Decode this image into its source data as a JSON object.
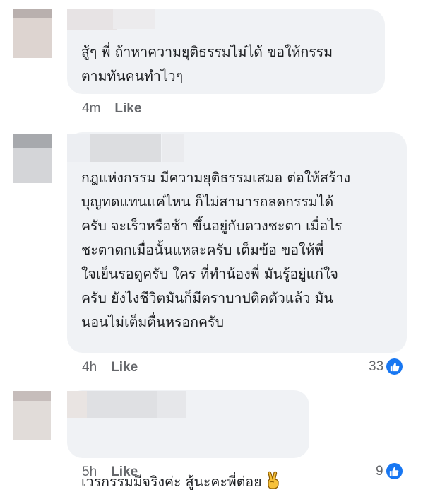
{
  "comments": [
    {
      "text": "สู้ๆ พี่ ถ้าหาความยุติธรรมไม่ได้ ขอให้กรรม\nตามทันคนทำไวๆ",
      "time": "4m",
      "like_label": "Like"
    },
    {
      "text": "กฎแห่งกรรม มีความยุติธรรมเสมอ ต่อให้สร้าง\nบุญทดแทนแค่ไหน ก็ไม่สามารถลดกรรมได้\nครับ จะเร็วหรือช้า ขึ้นอยู่กับดวงชะตา เมื่อไร\nชะตาตกเมื่อนั้นแหละครับ เต็มข้อ ขอให้พี่\nใจเย็นรอดูครับ ใคร ที่ทำน้องพี่ มันรู้อยู่แก่ใจ\nครับ ยังไงชีวิตมันก็มีตราบาปติดตัวแล้ว มัน\nนอนไม่เต็มตื่นหรอกครับ",
      "time": "4h",
      "like_label": "Like",
      "reaction_count": "33"
    },
    {
      "text": "เวรกรรมมีจริงค่ะ สู้นะคะพี่ต่อย",
      "time": "5h",
      "like_label": "Like",
      "reaction_count": "9",
      "emoji": "victory-hand-icon"
    }
  ],
  "colors": {
    "bubble": "#f0f2f5",
    "text": "#1c1e21",
    "meta": "#65676b",
    "like_badge": "#1877f2"
  }
}
